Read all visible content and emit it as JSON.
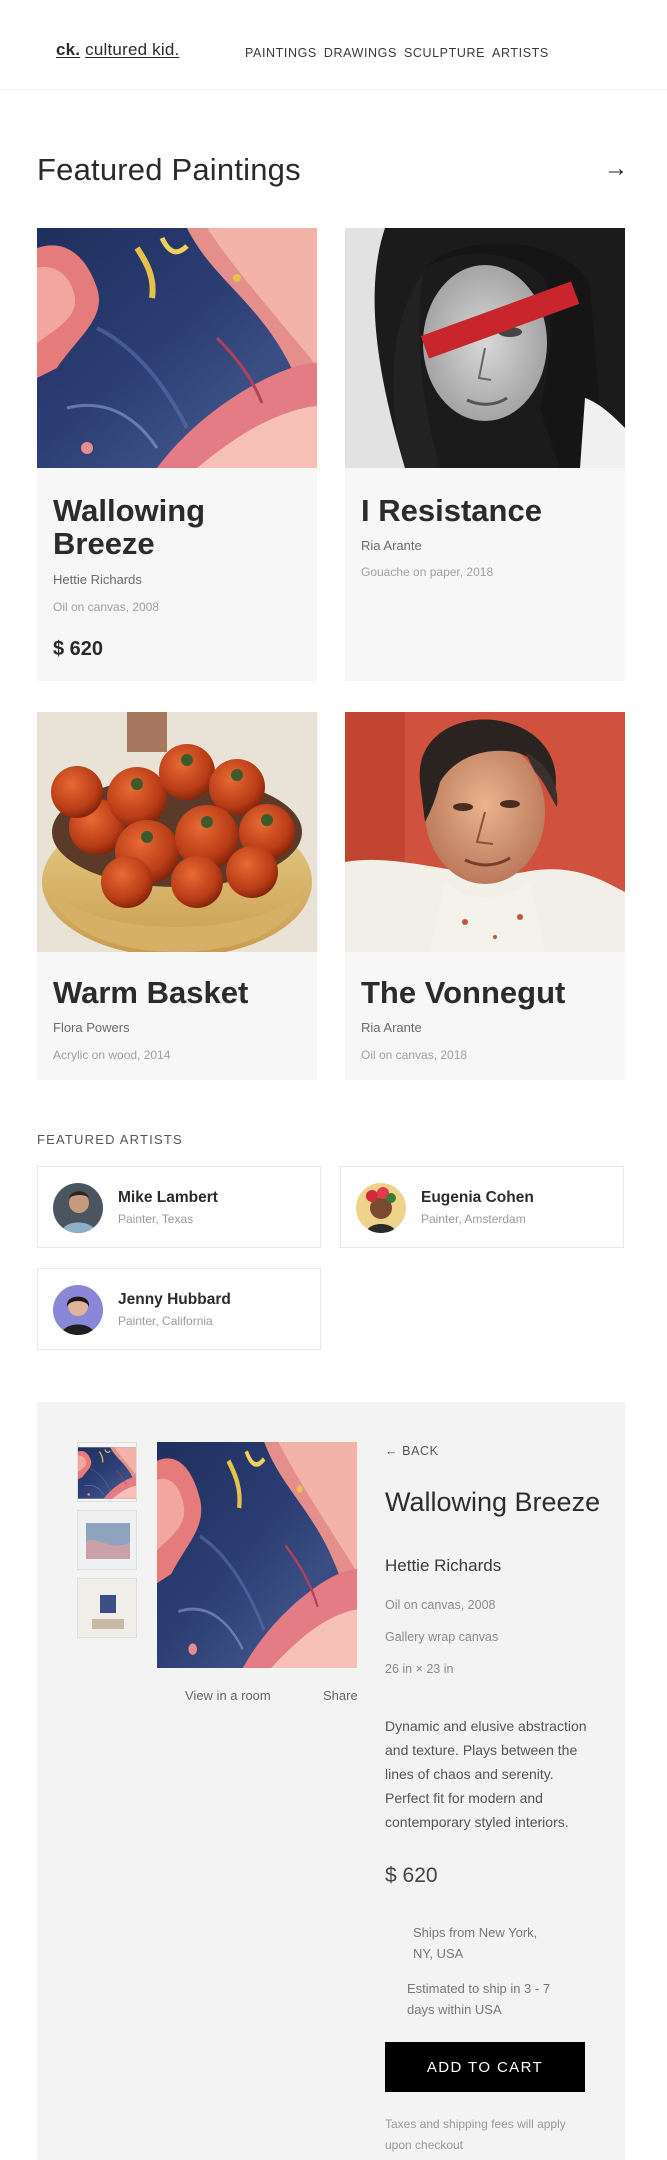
{
  "header": {
    "logo_mark": "ck.",
    "logo_text": "cultured kid.",
    "nav": [
      "PAINTINGS",
      "DRAWINGS",
      "SCULPTURE",
      "ARTISTS"
    ]
  },
  "featured": {
    "title": "Featured Paintings",
    "arrow": "→",
    "cards": [
      {
        "title": "Wallowing Breeze",
        "artist": "Hettie Richards",
        "medium": "Oil on canvas, 2008",
        "price": "$ 620"
      },
      {
        "title": "I Resistance",
        "artist": "Ria Arante",
        "medium": "Gouache on paper, 2018",
        "price": ""
      },
      {
        "title": "Warm Basket",
        "artist": "Flora Powers",
        "medium": "Acrylic on wood, 2014",
        "price": ""
      },
      {
        "title": "The Vonnegut",
        "artist": "Ria Arante",
        "medium": "Oil on canvas, 2018",
        "price": ""
      }
    ]
  },
  "featured_artists": {
    "title": "FEATURED ARTISTS",
    "items": [
      {
        "name": "Mike Lambert",
        "role": "Painter, Texas"
      },
      {
        "name": "Eugenia Cohen",
        "role": "Painter, Amsterdam"
      },
      {
        "name": "Jenny Hubbard",
        "role": "Painter, California"
      }
    ]
  },
  "detail": {
    "back": "← BACK",
    "title": "Wallowing Breeze",
    "artist": "Hettie Richards",
    "medium": "Oil on canvas, 2008",
    "canvas": "Gallery wrap canvas",
    "size": "26 in × 23 in",
    "view_in_room": "View in a room",
    "share": "Share",
    "description": "Dynamic and elusive abstraction and texture. Plays between the lines of chaos and serenity. Perfect fit for modern and contemporary styled interiors.",
    "price": "$ 620",
    "ships_from": "Ships from New York, NY, USA",
    "estimated": "Estimated to ship in 3 - 7 days within USA",
    "cart": "ADD TO CART",
    "note": "Taxes and shipping fees will apply upon checkout"
  },
  "colors": {
    "card_bg": "#f7f7f7",
    "panel_bg": "#f3f3f3",
    "button_bg": "#000000",
    "accent_red": "#c8262c"
  }
}
